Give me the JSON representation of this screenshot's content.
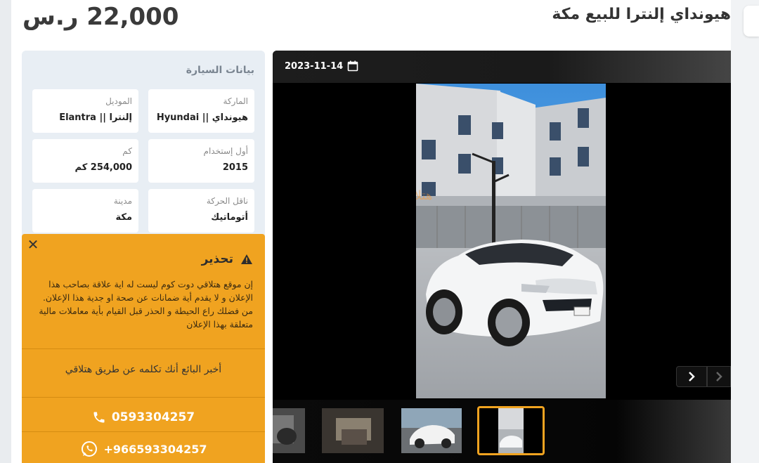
{
  "listing": {
    "title": "هيونداي إلنترا للبيع مكة",
    "price": "22,000 ر.س"
  },
  "car_info": {
    "section_title": "بيانات السيارة",
    "fields": [
      {
        "label": "الماركة",
        "value": "هيونداي || Hyundai"
      },
      {
        "label": "الموديل",
        "value": "إلنترا || Elantra"
      },
      {
        "label": "أول إستخدام",
        "value": "2015"
      },
      {
        "label": "كم",
        "value": "254,000 كم"
      },
      {
        "label": "ناقل الحركة",
        "value": "أتوماتيك"
      },
      {
        "label": "مدينة",
        "value": "مكة"
      }
    ]
  },
  "warning": {
    "title": "تحذير",
    "text": "إن موقع هتلاقي دوت كوم ليست له اية علاقة بصاحب هذا الإعلان و لا يقدم أية ضمانات عن صحة او جدية هذا الإعلان. من فضلك راع الحيطة و الحذر قبل القيام بأية معاملات مالية متعلقة بهذا الإعلان",
    "tell_seller": "أخبر البائع أنك تكلمه عن طريق هتلاقي",
    "phone": "0593304257",
    "whatsapp": "+966593304257"
  },
  "gallery": {
    "date": "2023-11-14",
    "watermark": "هتلاقي",
    "thumbnail_count": 4,
    "selected_thumbnail": 4
  },
  "icons": {
    "calendar": "calendar-icon",
    "warning": "warning-triangle-icon",
    "phone": "phone-icon",
    "whatsapp": "whatsapp-icon",
    "close": "close-icon"
  },
  "colors": {
    "accent": "#f0a320",
    "card_bg": "#e8eef4"
  }
}
